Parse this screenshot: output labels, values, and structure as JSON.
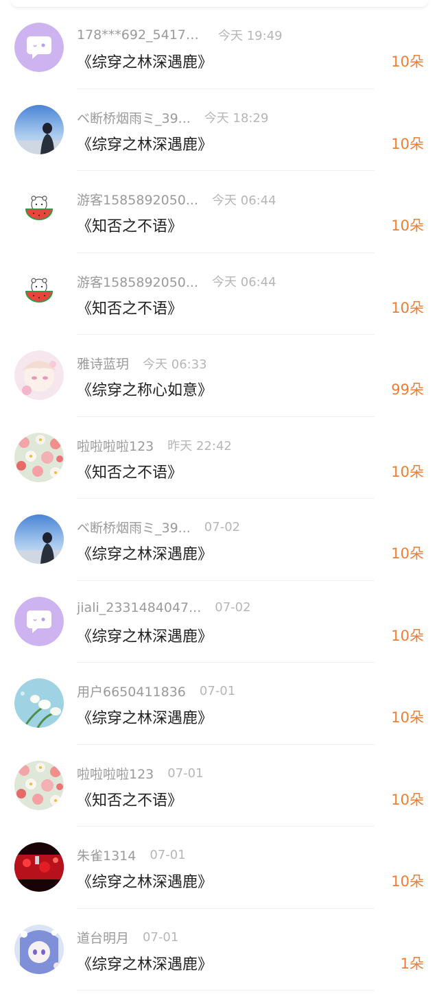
{
  "accent_color": "#ef7d32",
  "records": [
    {
      "avatar": "chat-bubble-avatar",
      "name": "178***692_54179...",
      "time": "今天 19:49",
      "title": "《综穿之林深遇鹿》",
      "amount": "10朵"
    },
    {
      "avatar": "girl-sky-avatar",
      "name": "ベ断桥烟雨ミ_39...",
      "time": "今天 18:29",
      "title": "《综穿之林深遇鹿》",
      "amount": "10朵"
    },
    {
      "avatar": "watermelon-bear-avatar",
      "name": "游客1585892050...",
      "time": "今天 06:44",
      "title": "《知否之不语》",
      "amount": "10朵"
    },
    {
      "avatar": "watermelon-bear-avatar",
      "name": "游客1585892050...",
      "time": "今天 06:44",
      "title": "《知否之不语》",
      "amount": "10朵"
    },
    {
      "avatar": "anime-girl-avatar",
      "name": "雅诗蓝玥",
      "time": "今天 06:33",
      "title": "《综穿之称心如意》",
      "amount": "99朵"
    },
    {
      "avatar": "floral-avatar",
      "name": "啦啦啦啦123",
      "time": "昨天 22:42",
      "title": "《知否之不语》",
      "amount": "10朵"
    },
    {
      "avatar": "girl-sky-avatar",
      "name": "ベ断桥烟雨ミ_39...",
      "time": "07-02",
      "title": "《综穿之林深遇鹿》",
      "amount": "10朵"
    },
    {
      "avatar": "chat-bubble-avatar",
      "name": "jiali_2331484047...",
      "time": "07-02",
      "title": "《综穿之林深遇鹿》",
      "amount": "10朵"
    },
    {
      "avatar": "tulip-avatar",
      "name": "用户6650411836",
      "time": "07-01",
      "title": "《综穿之林深遇鹿》",
      "amount": "10朵"
    },
    {
      "avatar": "floral-avatar",
      "name": "啦啦啦啦123",
      "time": "07-01",
      "title": "《知否之不语》",
      "amount": "10朵"
    },
    {
      "avatar": "red-lights-avatar",
      "name": "朱雀1314",
      "time": "07-01",
      "title": "《综穿之林深遇鹿》",
      "amount": "10朵"
    },
    {
      "avatar": "anime-blue-avatar",
      "name": "道台明月",
      "time": "07-01",
      "title": "《综穿之林深遇鹿》",
      "amount": "1朵"
    }
  ]
}
